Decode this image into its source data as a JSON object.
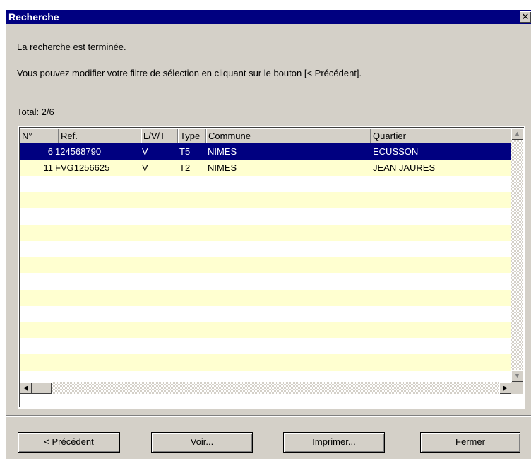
{
  "window": {
    "title": "Recherche",
    "close_glyph": "✕"
  },
  "messages": {
    "line1": "La recherche est terminée.",
    "line2": "Vous pouvez modifier votre filtre de sélection en cliquant sur le bouton [< Précédent]."
  },
  "total_label": "Total: 2/6",
  "table": {
    "columns": [
      "N°",
      "Ref.",
      "L/V/T",
      "Type",
      "Commune",
      "Quartier"
    ],
    "rows": [
      {
        "num": "6",
        "ref": "124568790",
        "lvt": "V",
        "type": "T5",
        "commune": "NIMES",
        "quartier": "ECUSSON",
        "selected": true
      },
      {
        "num": "11",
        "ref": "FVG1256625",
        "lvt": "V",
        "type": "T2",
        "commune": "NIMES",
        "quartier": "JEAN JAURES",
        "selected": false
      }
    ],
    "striped_row_colors": {
      "odd": "#ffffd0",
      "even": "#ffffff",
      "selected": "#000080"
    }
  },
  "buttons": {
    "previous": {
      "mnemonic": "P",
      "prefix": "< ",
      "rest": "récédent"
    },
    "view": {
      "mnemonic": "V",
      "rest": "oir..."
    },
    "print": {
      "mnemonic": "I",
      "rest": "mprimer..."
    },
    "close": "Fermer"
  },
  "colors": {
    "title_bar": "#000080",
    "dialog_bg": "#d4d0c8"
  },
  "icons": {
    "close": "close-icon",
    "scroll_up": "arrow-up-icon",
    "scroll_down": "arrow-down-icon",
    "scroll_left": "arrow-left-icon",
    "scroll_right": "arrow-right-icon"
  }
}
